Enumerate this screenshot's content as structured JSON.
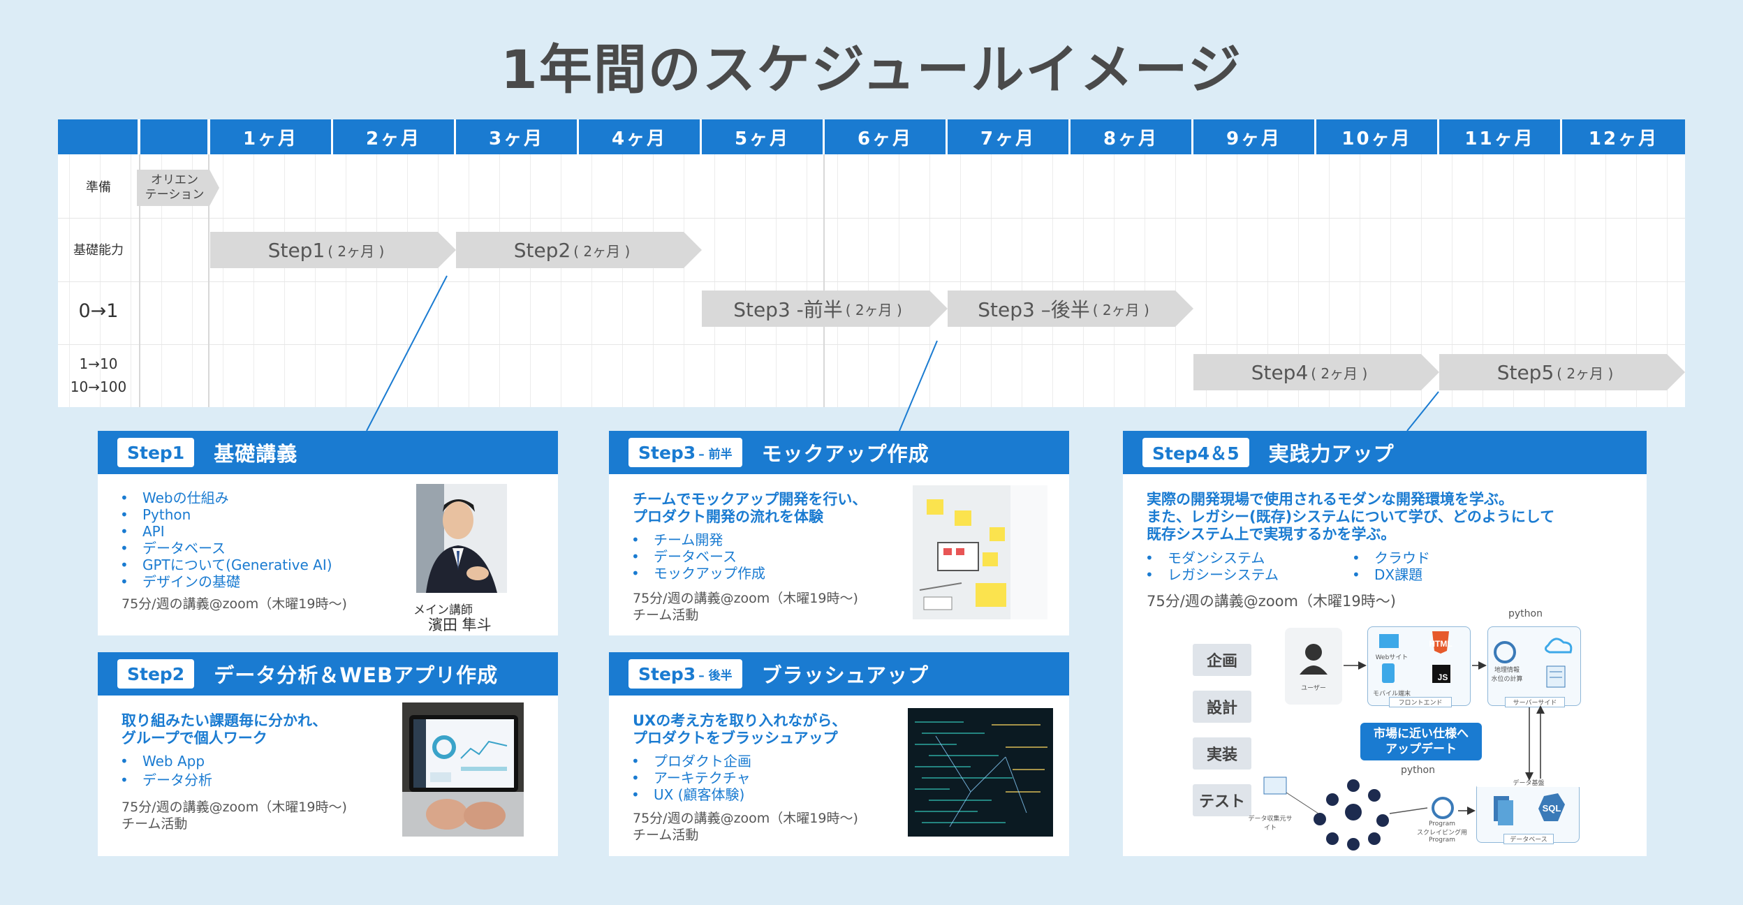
{
  "title": "1年間のスケジュールイメージ",
  "timeline": {
    "months": [
      "1ヶ月",
      "2ヶ月",
      "3ヶ月",
      "4ヶ月",
      "5ヶ月",
      "6ヶ月",
      "7ヶ月",
      "8ヶ月",
      "9ヶ月",
      "10ヶ月",
      "11ヶ月",
      "12ヶ月"
    ],
    "rows": {
      "prep": "準備",
      "basics": "基礎能力",
      "zero_one": "0→1",
      "one_ten": "1→10",
      "ten_hundred": "10→100"
    },
    "orientation": [
      "オリエン",
      "テーション"
    ],
    "phases": {
      "step1": {
        "label": "Step1",
        "dur": "( 2ヶ月 )"
      },
      "step2": {
        "label": "Step2",
        "dur": "( 2ヶ月 )"
      },
      "step3a": {
        "label": "Step3 -前半",
        "dur": "( 2ヶ月 )"
      },
      "step3b": {
        "label": "Step3 –後半",
        "dur": "( 2ヶ月 )"
      },
      "step4": {
        "label": "Step4",
        "dur": "( 2ヶ月 )"
      },
      "step5": {
        "label": "Step5",
        "dur": "( 2ヶ月 )"
      }
    }
  },
  "cards": {
    "step1": {
      "tag": "Step1",
      "title": "基礎講義",
      "items": [
        "Webの仕組み",
        "Python",
        "API",
        "データベース",
        "GPTについて(Generative AI)",
        "デザインの基礎"
      ],
      "note": "75分/週の講義@zoom（木曜19時〜)",
      "role": "メイン講師",
      "name": "濱田 隼斗"
    },
    "step2": {
      "tag": "Step2",
      "title": "データ分析＆WEBアプリ作成",
      "lead": [
        "取り組みたい課題毎に分かれ、",
        "グループで個人ワーク"
      ],
      "items": [
        "Web App",
        "データ分析"
      ],
      "note": [
        "75分/週の講義@zoom（木曜19時〜)",
        "チーム活動"
      ]
    },
    "step3a": {
      "tag": "Step3",
      "tag_sub": "– 前半",
      "title": "モックアップ作成",
      "lead": [
        "チームでモックアップ開発を行い、",
        "プロダクト開発の流れを体験"
      ],
      "items": [
        "チーム開発",
        "データベース",
        "モックアップ作成"
      ],
      "note": [
        "75分/週の講義@zoom（木曜19時〜)",
        "チーム活動"
      ]
    },
    "step3b": {
      "tag": "Step3",
      "tag_sub": "– 後半",
      "title": "ブラッシュアップ",
      "lead": [
        "UXの考え方を取り入れながら、",
        "プロダクトをブラッシュアップ"
      ],
      "items": [
        "プロダクト企画",
        "アーキテクチャ",
        "UX (顧客体験)"
      ],
      "note": [
        "75分/週の講義@zoom（木曜19時〜)",
        "チーム活動"
      ]
    },
    "step45": {
      "tag": "Step4＆5",
      "title": "実践力アップ",
      "lead": [
        "実際の開発現場で使用されるモダンな開発環境を学ぶ。",
        "また、レガシー(既存)システムについて学び、どのようにして",
        "既存システム上で実現するかを学ぶ。"
      ],
      "items_left": [
        "モダンシステム",
        "レガシーシステム"
      ],
      "items_right": [
        "クラウド",
        "DX課題"
      ],
      "note": "75分/週の講義@zoom（木曜19時〜)",
      "diagram": {
        "phases": [
          "企画",
          "設計",
          "実装",
          "テスト"
        ],
        "callout": [
          "市場に近い仕様へ",
          "アップデート"
        ],
        "python": "python",
        "user": "ユーザー",
        "frontend": "フロントエンド",
        "serverside": "サーバーサイド",
        "database": "データベース",
        "data_engine": "データ基盤",
        "web_site": "Webサイト",
        "mobile_app": "モバイル端末",
        "scraping": [
          "Program",
          "スクレイピング用",
          "Program"
        ],
        "data_collect": "データ収集元サイト",
        "html5": "HTML",
        "js": "JS",
        "sql": "SQL",
        "geo": [
          "地理情報",
          "水位の計算"
        ]
      }
    }
  }
}
